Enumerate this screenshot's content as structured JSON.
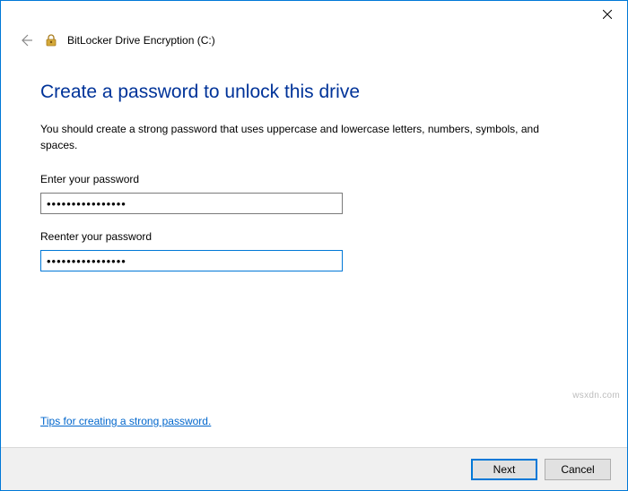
{
  "window": {
    "program_title": "BitLocker Drive Encryption (C:)"
  },
  "content": {
    "heading": "Create a password to unlock this drive",
    "description": "You should create a strong password that uses uppercase and lowercase letters, numbers, symbols, and spaces.",
    "enter_label": "Enter your password",
    "reenter_label": "Reenter your password",
    "password_value": "••••••••••••••••",
    "reenter_value": "••••••••••••••••",
    "tips_link": "Tips for creating a strong password."
  },
  "buttons": {
    "next": "Next",
    "cancel": "Cancel"
  },
  "watermark": "wsxdn.com"
}
